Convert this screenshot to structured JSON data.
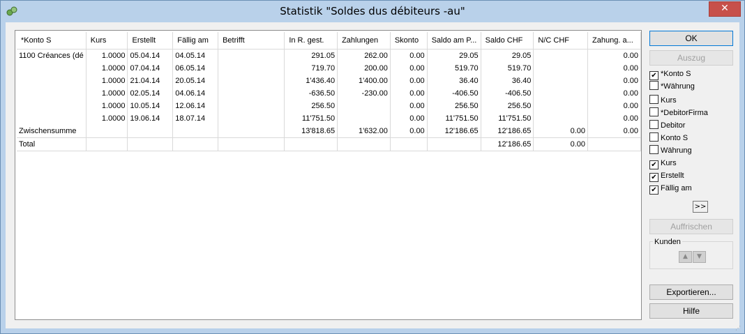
{
  "window": {
    "title": "Statistik \"Soldes dus débiteurs -au\"",
    "close_symbol": "✕"
  },
  "grid": {
    "columns": [
      "*Konto S",
      "Kurs",
      "Erstellt",
      "Fällig am",
      "Betrifft",
      "In R. gest.",
      "Zahlungen",
      "Skonto",
      "Saldo am P...",
      "Saldo CHF",
      "N/C CHF",
      "Zahung. a..."
    ],
    "rows": [
      [
        "1100 Créances (dé",
        "1.0000",
        "05.04.14",
        "04.05.14",
        "",
        "291.05",
        "262.00",
        "0.00",
        "29.05",
        "29.05",
        "",
        "0.00"
      ],
      [
        "",
        "1.0000",
        "07.04.14",
        "06.05.14",
        "",
        "719.70",
        "200.00",
        "0.00",
        "519.70",
        "519.70",
        "",
        "0.00"
      ],
      [
        "",
        "1.0000",
        "21.04.14",
        "20.05.14",
        "",
        "1'436.40",
        "1'400.00",
        "0.00",
        "36.40",
        "36.40",
        "",
        "0.00"
      ],
      [
        "",
        "1.0000",
        "02.05.14",
        "04.06.14",
        "",
        "-636.50",
        "-230.00",
        "0.00",
        "-406.50",
        "-406.50",
        "",
        "0.00"
      ],
      [
        "",
        "1.0000",
        "10.05.14",
        "12.06.14",
        "",
        "256.50",
        "",
        "0.00",
        "256.50",
        "256.50",
        "",
        "0.00"
      ],
      [
        "",
        "1.0000",
        "19.06.14",
        "18.07.14",
        "",
        "11'751.50",
        "",
        "0.00",
        "11'751.50",
        "11'751.50",
        "",
        "0.00"
      ],
      [
        "Zwischensumme",
        "",
        "",
        "",
        "",
        "13'818.65",
        "1'632.00",
        "0.00",
        "12'186.65",
        "12'186.65",
        "0.00",
        "0.00"
      ],
      [
        "Total",
        "",
        "",
        "",
        "",
        "",
        "",
        "",
        "",
        "12'186.65",
        "0.00",
        ""
      ]
    ]
  },
  "buttons": {
    "ok": "OK",
    "auszug": "Auszug",
    "more": ">>",
    "refresh": "Auffrischen",
    "export": "Exportieren...",
    "help": "Hilfe"
  },
  "options": [
    {
      "label": "*Konto S",
      "checked": true
    },
    {
      "label": "*Währung",
      "checked": false
    },
    {
      "label": "Kurs",
      "checked": false
    },
    {
      "label": "*DebitorFirma",
      "checked": false
    },
    {
      "label": "Debitor",
      "checked": false
    },
    {
      "label": "Konto S",
      "checked": false
    },
    {
      "label": "Währung",
      "checked": false
    },
    {
      "label": "Kurs",
      "checked": true
    },
    {
      "label": "Erstellt",
      "checked": true
    },
    {
      "label": "Fällig am",
      "checked": true
    }
  ],
  "kunden": {
    "label": "Kunden",
    "up": "▲",
    "down": "▼"
  }
}
